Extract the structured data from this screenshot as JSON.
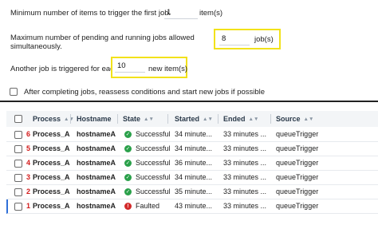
{
  "settings": {
    "min_items_label": "Minimum number of items to trigger the first job.",
    "min_items_value": "1",
    "min_items_unit": "item(s)",
    "max_jobs_label_line1": "Maximum number of pending and running jobs allowed",
    "max_jobs_label_line2": "simultaneously.",
    "max_jobs_value": "8",
    "max_jobs_unit": "job(s)",
    "another_job_label": "Another job is triggered for each",
    "another_job_value": "10",
    "another_job_unit": "new item(s)",
    "reassess_label": "After completing jobs, reassess conditions and start new jobs if possible",
    "reassess_checked": false
  },
  "table": {
    "headers": {
      "process": "Process",
      "hostname": "Hostname",
      "state": "State",
      "started": "Started",
      "ended": "Ended",
      "source": "Source"
    },
    "sort_glyph": "▲▼",
    "rows": [
      {
        "num": "6",
        "process": "Process_A",
        "hostname": "hostnameA",
        "state": "Successful",
        "state_icon": "check-icon",
        "started": "34 minute...",
        "ended": "33 minutes ...",
        "source": "queueTrigger"
      },
      {
        "num": "5",
        "process": "Process_A",
        "hostname": "hostnameA",
        "state": "Successful",
        "state_icon": "check-icon",
        "started": "34 minute...",
        "ended": "33 minutes ...",
        "source": "queueTrigger"
      },
      {
        "num": "4",
        "process": "Process_A",
        "hostname": "hostnameA",
        "state": "Successful",
        "state_icon": "check-icon",
        "started": "36 minute...",
        "ended": "33 minutes ...",
        "source": "queueTrigger"
      },
      {
        "num": "3",
        "process": "Process_A",
        "hostname": "hostnameA",
        "state": "Successful",
        "state_icon": "check-icon",
        "started": "34 minute...",
        "ended": "33 minutes ...",
        "source": "queueTrigger"
      },
      {
        "num": "2",
        "process": "Process_A",
        "hostname": "hostnameA",
        "state": "Successful",
        "state_icon": "check-icon",
        "started": "35 minute...",
        "ended": "33 minutes ...",
        "source": "queueTrigger"
      },
      {
        "num": "1",
        "process": "Process_A",
        "hostname": "hostnameA",
        "state": "Faulted",
        "state_icon": "error-icon",
        "started": "43 minute...",
        "ended": "33 minutes ...",
        "source": "queueTrigger"
      }
    ]
  },
  "colors": {
    "highlight": "#f2e21a",
    "success": "#2aa04a",
    "faulted": "#d32a2a",
    "row_number": "#d31b1b",
    "selected_row": "#2f6fd8"
  }
}
